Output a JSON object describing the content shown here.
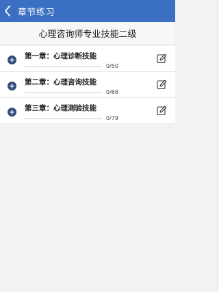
{
  "header": {
    "back_icon": "chevron-left-icon",
    "title": "章节练习",
    "background": "#3b6fc2"
  },
  "subtitle": "心理咨询师专业技能二级",
  "chapters": [
    {
      "title": "第一章：心理诊断技能",
      "progress_text": "0/50",
      "done": 0,
      "total": 50
    },
    {
      "title": "第二章：心理咨询技能",
      "progress_text": "0/68",
      "done": 0,
      "total": 68
    },
    {
      "title": "第三章：心理测验技能",
      "progress_text": "0/79",
      "done": 0,
      "total": 79
    }
  ],
  "icons": {
    "expand": "plus-circle-icon",
    "edit": "edit-icon"
  },
  "colors": {
    "accent": "#3b6fc2",
    "icon_dark": "#2f4a7a"
  }
}
